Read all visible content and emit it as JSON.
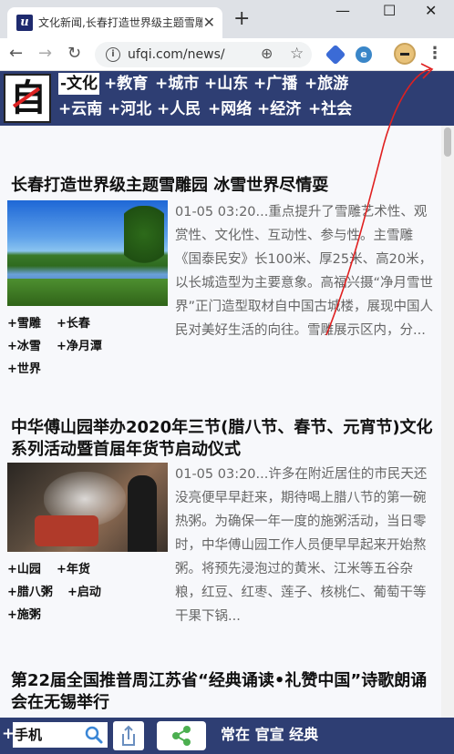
{
  "browser": {
    "tab_title": "文化新闻,长春打造世界级主题雪雕园",
    "tab_favicon": "u",
    "new_tab": "+",
    "url": "ufqi.com/news/",
    "window_controls": [
      "—",
      "☐",
      "✕"
    ],
    "icons": [
      "back-icon",
      "forward-icon",
      "reload-icon",
      "info-icon",
      "zoom-icon",
      "star-icon",
      "extension-icon",
      "extension-icon-2",
      "profile-avatar",
      "menu-icon"
    ]
  },
  "site": {
    "logo_char": "自",
    "categories_row1": [
      "-文化",
      "+教育",
      "+城市",
      "+山东",
      "+广播",
      "+旅游"
    ],
    "categories_row2": [
      "+云南",
      "+河北",
      "+人民",
      "+网络",
      "+经济",
      "+社会"
    ],
    "colors": {
      "header": "#2e3e73",
      "annotation": "#e02020"
    }
  },
  "articles": [
    {
      "title": "长春打造世界级主题雪雕园 冰雪世界尽情耍",
      "body": "01-05 03:20...重点提升了雪雕艺术性、观赏性、文化性、互动性、参与性。主雪雕《国泰民安》长100米、厚25米、高20米，以长城造型为主要意象。高福兴摄“净月雪世界”正门造型取材自中国古城楼，展现中国人民对美好生活的向往。雪雕展示区内，分...",
      "tags": [
        "+雪雕",
        "+长春",
        "+冰雪",
        "+净月潭",
        "+世界"
      ]
    },
    {
      "title": "中华傅山园举办2020年三节(腊八节、春节、元宵节)文化系列活动暨首届年货节启动仪式",
      "body": "01-05 03:20...许多在附近居住的市民天还没亮便早早赶来，期待喝上腊八节的第一碗热粥。为确保一年一度的施粥活动，当日零时，中华傅山园工作人员便早早起来开始熬粥。将预先浸泡过的黄米、江米等五谷杂粮，红豆、红枣、莲子、核桃仁、葡萄干等干果下锅...",
      "tags": [
        "+山园",
        "+年货",
        "+腊八粥",
        "+启动",
        "+施粥"
      ]
    },
    {
      "title": "第22届全国推普周江苏省“经典诵读•礼赞中国”诗歌朗诵会在无锡举行"
    }
  ],
  "bottom_bar": {
    "plus": "+",
    "search_value": "手机",
    "links": "常在 官宣 经典"
  }
}
